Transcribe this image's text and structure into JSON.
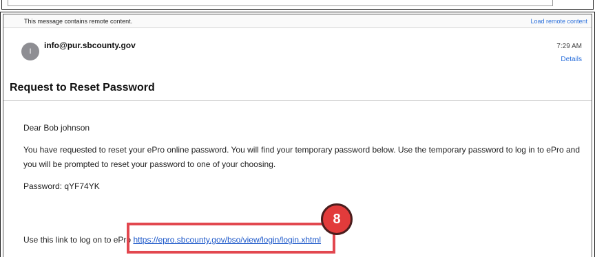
{
  "banner": {
    "message": "This message contains remote content.",
    "load_link": "Load remote content"
  },
  "header": {
    "avatar_initial": "I",
    "sender": "info@pur.sbcounty.gov",
    "time": "7:29 AM",
    "details_link": "Details"
  },
  "email": {
    "subject": "Request to Reset Password",
    "greeting": "Dear Bob johnson",
    "paragraph": "You have requested to reset your ePro online password. You will find your temporary password below. Use the temporary password to log in to ePro and you will be prompted to reset your password to one of your choosing.",
    "password_line": "Password: qYF74YK",
    "link_prefix": "Use this link to log on to ePro",
    "link_url": "https://epro.sbcounty.gov/bso/view/login/login.xhtml"
  },
  "annotation": {
    "step_number": "8",
    "accent_color": "#e23b3b"
  }
}
